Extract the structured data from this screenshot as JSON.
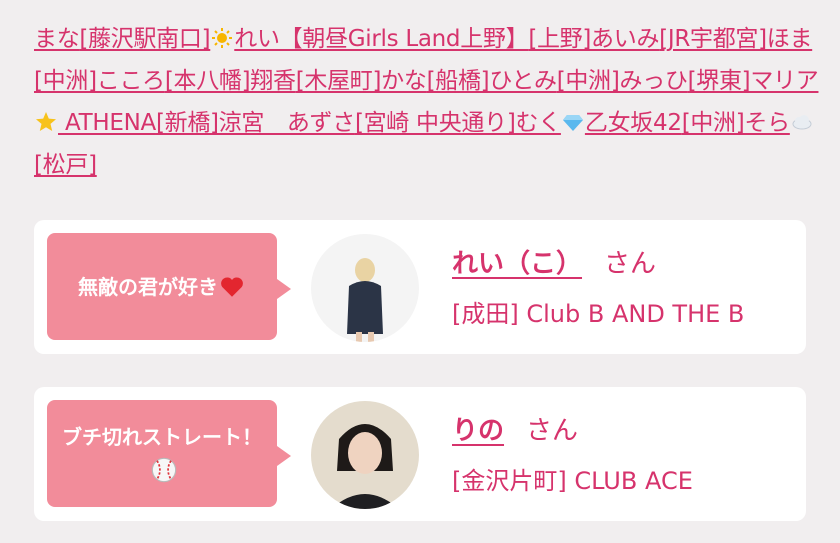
{
  "links": {
    "t1": "まな",
    "l1": "[藤沢駅南口]",
    "l2": "れい【朝昼Girls Land上野】",
    "l3": "[上野]あいみ",
    "l4": "[JR宇都宮]ほま",
    "l5": "[中洲]こころ",
    "l6": "[本八幡]翔香",
    "l7": "[木屋町]かな",
    "l8": "[船橋]ひとみ",
    "l9": "[中洲]みっひ",
    "l10": "[堺東]マリア",
    "l11": " ATHENA",
    "l12": "[新橋]涼宮　あずさ",
    "l13": "[宮崎 中央通り]むく",
    "l14": "乙女坂42",
    "l15": "[中洲]そら",
    "l16": "[松戸]"
  },
  "cards": [
    {
      "bubble": "無敵の君が好き",
      "bubble_icon": "heart-icon",
      "name": "れい（こ）",
      "honorific": "さん",
      "shop": "[成田] Club B AND THE B"
    },
    {
      "bubble": "ブチ切れストレート！",
      "bubble_icon": "baseball-icon",
      "name": "りの",
      "honorific": "さん",
      "shop": "[金沢片町] CLUB ACE"
    }
  ],
  "colors": {
    "accent": "#d6336c",
    "bubble": "#f28c9a",
    "background": "#f1eeef",
    "card": "#ffffff"
  }
}
